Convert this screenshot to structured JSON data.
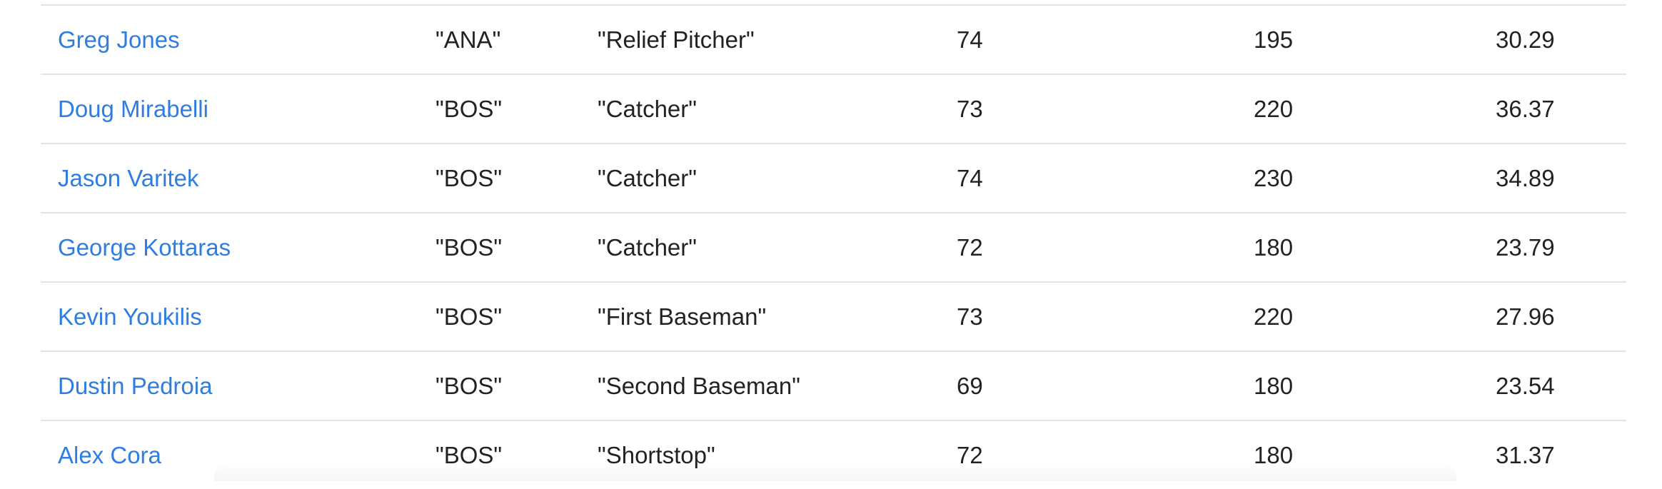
{
  "table": {
    "rows": [
      {
        "name": "Greg Jones",
        "team": "\"ANA\"",
        "position": "\"Relief Pitcher\"",
        "height": "74",
        "weight": "195",
        "age": "30.29"
      },
      {
        "name": "Doug Mirabelli",
        "team": "\"BOS\"",
        "position": "\"Catcher\"",
        "height": "73",
        "weight": "220",
        "age": "36.37"
      },
      {
        "name": "Jason Varitek",
        "team": "\"BOS\"",
        "position": "\"Catcher\"",
        "height": "74",
        "weight": "230",
        "age": "34.89"
      },
      {
        "name": "George Kottaras",
        "team": "\"BOS\"",
        "position": "\"Catcher\"",
        "height": "72",
        "weight": "180",
        "age": "23.79"
      },
      {
        "name": "Kevin Youkilis",
        "team": "\"BOS\"",
        "position": "\"First Baseman\"",
        "height": "73",
        "weight": "220",
        "age": "27.96"
      },
      {
        "name": "Dustin Pedroia",
        "team": "\"BOS\"",
        "position": "\"Second Baseman\"",
        "height": "69",
        "weight": "180",
        "age": "23.54"
      },
      {
        "name": "Alex Cora",
        "team": "\"BOS\"",
        "position": "\"Shortstop\"",
        "height": "72",
        "weight": "180",
        "age": "31.37"
      }
    ]
  },
  "colors": {
    "link": "#2f7de1",
    "text": "#222222",
    "divider": "#e3e3e3"
  }
}
